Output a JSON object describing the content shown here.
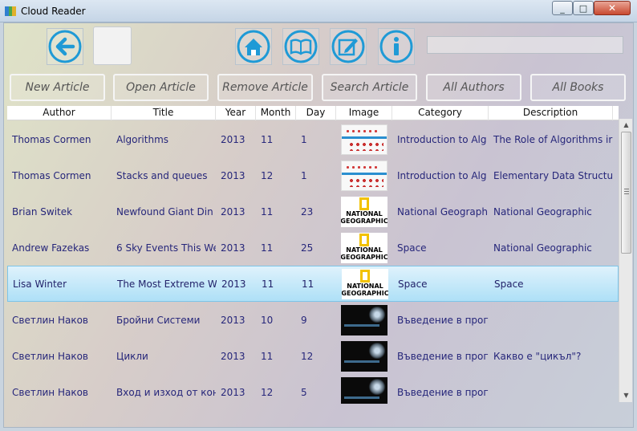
{
  "window": {
    "title": "Cloud Reader"
  },
  "toolbar": {
    "back_icon": "back-arrow-icon",
    "home_icon": "home-icon",
    "book_icon": "open-book-icon",
    "edit_icon": "edit-icon",
    "info_icon": "info-icon",
    "accent": "#1f9ad6",
    "search_value": ""
  },
  "actions": [
    "New Article",
    "Open Article",
    "Remove Article",
    "Search Article",
    "All Authors",
    "All Books"
  ],
  "table": {
    "columns": [
      "Author",
      "Title",
      "Year",
      "Month",
      "Day",
      "Image",
      "Category",
      "Description"
    ],
    "rows": [
      {
        "author": "Thomas Cormen",
        "title": "Algorithms",
        "year": "2013",
        "month": "11",
        "day": "1",
        "image": "algorithms-cover",
        "category": "Introduction to Alg",
        "description": "The Role of Algorithms ir"
      },
      {
        "author": "Thomas Cormen",
        "title": "Stacks and queues",
        "year": "2013",
        "month": "12",
        "day": "1",
        "image": "algorithms-cover",
        "category": "Introduction to Alg",
        "description": "Elementary Data Structur"
      },
      {
        "author": "Brian Switek",
        "title": "Newfound Giant Din",
        "year": "2013",
        "month": "11",
        "day": "23",
        "image": "national-geographic-logo",
        "category": "National Geograph",
        "description": "National Geographic"
      },
      {
        "author": "Andrew Fazekas",
        "title": "6 Sky Events This We",
        "year": "2013",
        "month": "11",
        "day": "25",
        "image": "national-geographic-logo",
        "category": "Space",
        "description": "National Geographic"
      },
      {
        "author": "Lisa Winter",
        "title": "The Most Extreme W",
        "year": "2013",
        "month": "11",
        "day": "11",
        "image": "national-geographic-logo",
        "category": "Space",
        "description": "Space",
        "selected": true
      },
      {
        "author": "Светлин Наков",
        "title": "Бройни Системи",
        "year": "2013",
        "month": "10",
        "day": "9",
        "image": "programming-cover",
        "category": "Въведение в прогр",
        "description": ""
      },
      {
        "author": "Светлин Наков",
        "title": "Цикли",
        "year": "2013",
        "month": "11",
        "day": "12",
        "image": "programming-cover",
        "category": "Въведение в прогр",
        "description": "Какво е \"цикъл\"?"
      },
      {
        "author": "Светлин Наков",
        "title": "Вход и изход от кон",
        "year": "2013",
        "month": "12",
        "day": "5",
        "image": "programming-cover",
        "category": "Въведение в прогр",
        "description": ""
      }
    ]
  },
  "ng_text": "NATIONAL GEOGRAPHIC",
  "colors": {
    "cell_text": "#26267a",
    "selection": "#aee0f7"
  }
}
